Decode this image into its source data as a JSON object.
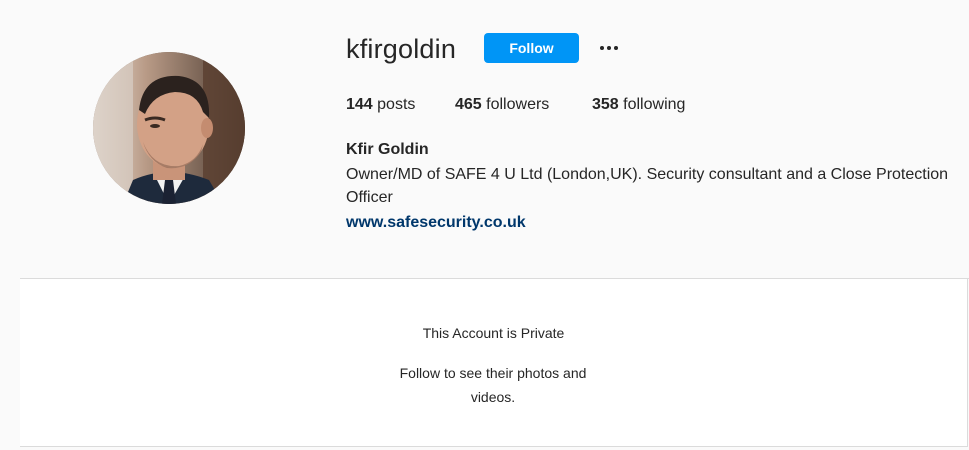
{
  "profile": {
    "username": "kfirgoldin",
    "follow_label": "Follow",
    "more_icon": "ellipsis-icon",
    "avatar_icon": "profile-photo",
    "stats": {
      "posts_count": "144",
      "posts_label": "posts",
      "followers_count": "465",
      "followers_label": "followers",
      "following_count": "358",
      "following_label": "following"
    },
    "full_name": "Kfir Goldin",
    "bio": "Owner/MD of SAFE 4 U Ltd (London,UK). Security consultant and a Close Protection Officer",
    "website": "www.safesecurity.co.uk"
  },
  "private_notice": {
    "title": "This Account is Private",
    "subtitle": "Follow to see their photos and videos."
  },
  "colors": {
    "follow_button": "#0095f6",
    "link": "#00376b",
    "background": "#fafafa",
    "text": "#262626"
  }
}
